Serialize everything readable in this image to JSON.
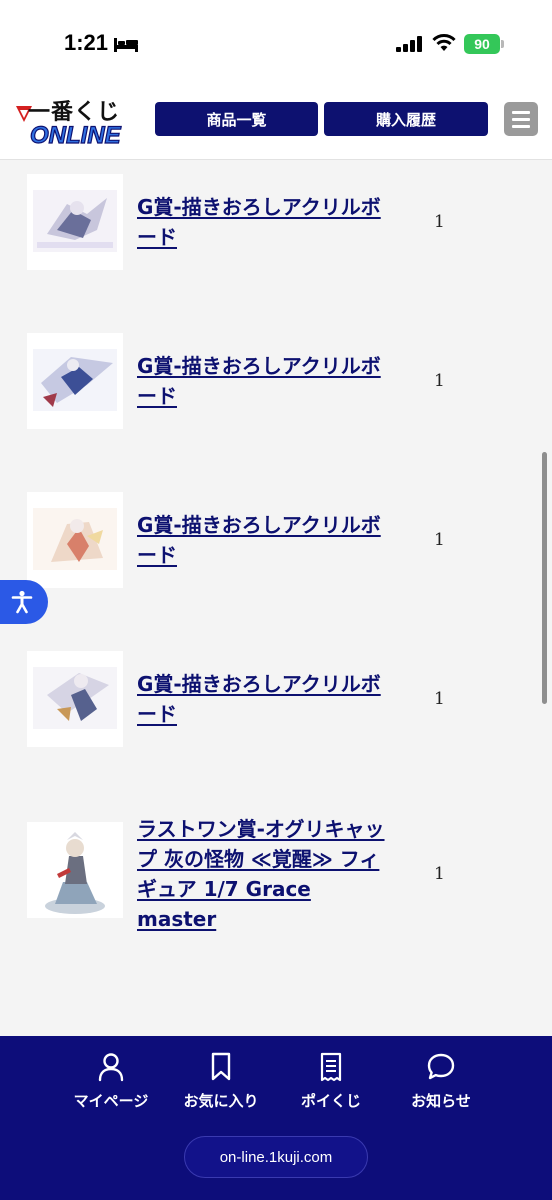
{
  "status": {
    "time": "1:21",
    "battery": "90"
  },
  "header": {
    "logo_top": "一番くじ",
    "logo_bottom": "ONLINE",
    "products_label": "商品一覧",
    "history_label": "購入履歴"
  },
  "items": [
    {
      "title": "G賞-描きおろしアクリルボード",
      "qty": "1"
    },
    {
      "title": "G賞-描きおろしアクリルボード",
      "qty": "1"
    },
    {
      "title": "G賞-描きおろしアクリルボード",
      "qty": "1"
    },
    {
      "title": "G賞-描きおろしアクリルボード",
      "qty": "1"
    },
    {
      "title": "ラストワン賞-オグリキャップ 灰の怪物 ≪覚醒≫ フィギュア 1/7 Grace master",
      "qty": "1"
    }
  ],
  "bottom_nav": {
    "mypage": "マイページ",
    "favorites": "お気に入り",
    "poikuji": "ポイくじ",
    "news": "お知らせ",
    "url": "on-line.1kuji.com"
  },
  "colors": {
    "brand": "#0d1170",
    "bottom_nav": "#0d0d7a",
    "accessibility": "#2b59e6",
    "battery": "#34c759"
  }
}
